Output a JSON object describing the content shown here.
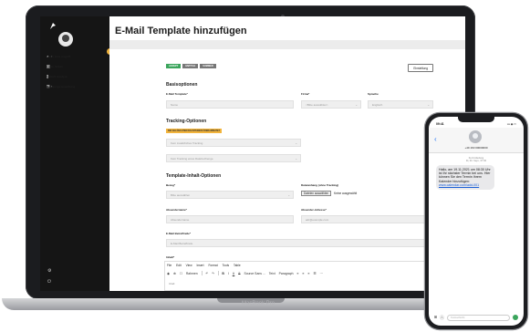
{
  "sidebar": {
    "menu": [
      {
        "icon": "user-icon",
        "label": "Marlo Hinz Angriff",
        "chevron": "›"
      },
      {
        "icon": "list-icon",
        "label": "Login Seiten",
        "chevron": ""
      },
      {
        "icon": "chart-icon",
        "label": "SEGNT Analyse",
        "chevron": ""
      },
      {
        "icon": "settings-icon",
        "label": "Belegungsverwaltung",
        "chevron": "›"
      }
    ]
  },
  "page": {
    "title": "E-Mail Template hinzufügen"
  },
  "chips": [
    "AKZEPT",
    "ENTITLE",
    "SUMMER"
  ],
  "actions": {
    "edit_label": "Einstellung"
  },
  "sections": {
    "basis": "Basisoptionen",
    "tracking": "Tracking-Optionen",
    "inhalt": "Template-Inhalt-Optionen"
  },
  "fields": {
    "template_label": "E-Mail Template*",
    "template_value": "Name",
    "firma_label": "Firma*",
    "firma_value": "<Bitte auswählen>",
    "sprache_label": "Sprache",
    "sprache_value": "Englisch",
    "tracking_warn": "BEI GELÖSCHTEM BAUSTEINEN ÜBERARBEITET",
    "tracking_1": "Kein zusätzliches Tracking",
    "tracking_2": "Kein Tracking eines Datebezhenge",
    "bezug_label": "Bezug*",
    "bezug_value": "Bitte auswählen",
    "datei_label": "Dateianhang (ohne Tracking)",
    "datei_button": "Dateien auswählen",
    "datei_none": "Keine ausgewählt",
    "absender_label": "Absendername*",
    "absender_value": "Absendername",
    "absadr_label": "Absender-Adresse*",
    "absadr_value": "adr@example.com",
    "betreff_label": "E-Mail Betreffzeile*",
    "betreff_value": "E-Mail Betreffzeile",
    "inhalt_label": "Inhalt*"
  },
  "editor": {
    "menu": [
      "File",
      "Edit",
      "View",
      "Insert",
      "Format",
      "Tools",
      "Table"
    ],
    "toolbar": {
      "frame": "Rahmen",
      "font": "Source Sans ...",
      "size": "Teixt",
      "block": "Paragraph"
    },
    "body": "Inhalt"
  },
  "laptop": {
    "brand": "MacBook Pro"
  },
  "phone": {
    "time": "09:41",
    "signal": "▪▪▪ ◉ ▭",
    "number": "+49 160 00000000",
    "meta_line1": "Kurzmitteilung",
    "meta_line2": "Di, 30. Sept., 07:00",
    "message": "Hallo, am 19.11.2021 um 08:30 Uhr ist Ihr nächster Termin bei uns. Hier können Sie den Termin Ihrem Kalender hinzufügen:",
    "link": "www.calendar.com/add-001",
    "input_placeholder": "Textnachricht"
  }
}
